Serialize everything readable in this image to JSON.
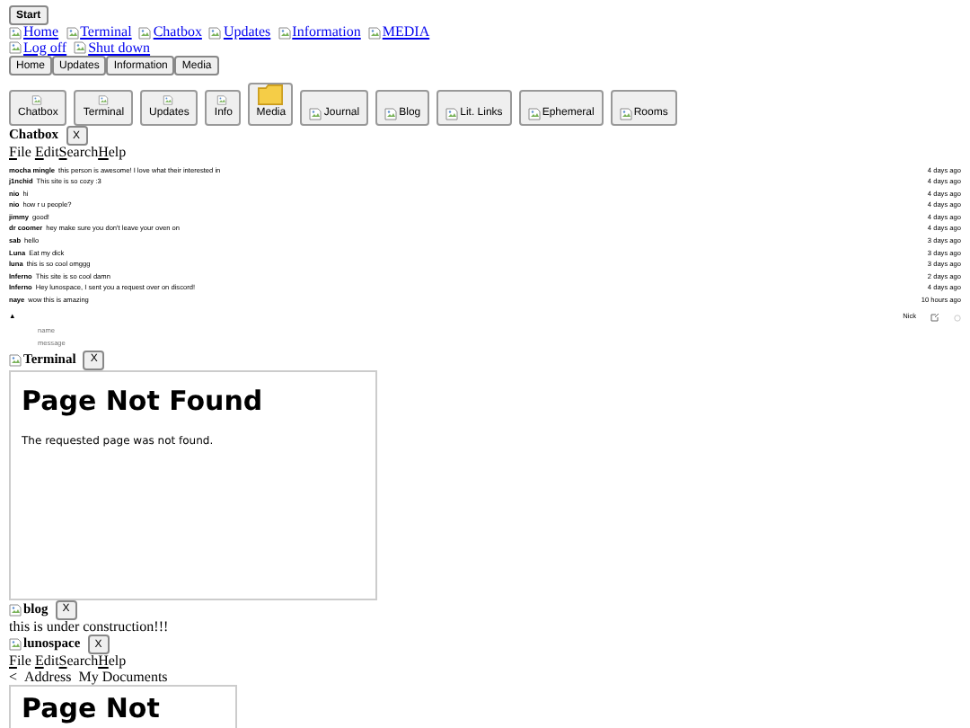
{
  "start_button": "Start",
  "desktop_links": [
    {
      "label": "Home"
    },
    {
      "label": "Terminal"
    },
    {
      "label": "Chatbox"
    },
    {
      "label": "Updates"
    },
    {
      "label": "Information"
    },
    {
      "label": "MEDIA"
    }
  ],
  "session_links": [
    {
      "label": "Log off"
    },
    {
      "label": "Shut down"
    }
  ],
  "shortcut_buttons": [
    "Home",
    "Updates",
    "Information",
    "Media"
  ],
  "icon_buttons": [
    {
      "label": "Chatbox",
      "kind": "stacked"
    },
    {
      "label": "Terminal",
      "kind": "stacked"
    },
    {
      "label": "Updates",
      "kind": "stacked"
    },
    {
      "label": "Info",
      "kind": "stacked"
    },
    {
      "label": "Media",
      "kind": "folder"
    },
    {
      "label": "Journal",
      "kind": "inline"
    },
    {
      "label": "Blog",
      "kind": "inline"
    },
    {
      "label": "Lit. Links",
      "kind": "inline"
    },
    {
      "label": "Ephemeral",
      "kind": "inline"
    },
    {
      "label": "Rooms",
      "kind": "inline"
    }
  ],
  "chatbox": {
    "title": "Chatbox",
    "close": "X",
    "menu": [
      "File",
      "Edit",
      "Search",
      "Help"
    ],
    "messages": [
      {
        "user": "mocha mingle",
        "text": "this person is awesome! I love what their interested in",
        "time": "4 days ago"
      },
      {
        "user": "j1nchid",
        "text": "This site is so cozy :3",
        "time": "4 days ago"
      },
      {
        "user": "nio",
        "text": "hi",
        "time": "4 days ago"
      },
      {
        "user": "nio",
        "text": "how r u people?",
        "time": "4 days ago"
      },
      {
        "user": "jimmy",
        "text": "good!",
        "time": "4 days ago"
      },
      {
        "user": "dr coomer",
        "text": "hey make sure you don't leave your oven on",
        "time": "4 days ago"
      },
      {
        "user": "sab",
        "text": "hello",
        "time": "3 days ago"
      },
      {
        "user": "Luna",
        "text": "Eat my dick",
        "time": "3 days ago"
      },
      {
        "user": "luna",
        "text": "this is so cool omggg",
        "time": "3 days ago"
      },
      {
        "user": "Inferno",
        "text": "This site is so cool damn",
        "time": "2 days ago"
      },
      {
        "user": "Inferno",
        "text": "Hey lunospace, I sent you a request over on discord!",
        "time": "4 days ago"
      },
      {
        "user": "naye",
        "text": "wow this is amazing",
        "time": "10 hours ago"
      }
    ],
    "scroll_up": "▲",
    "nick_label": "Nick",
    "name_placeholder": "name",
    "message_placeholder": "message"
  },
  "terminal": {
    "title": "Terminal",
    "close": "X",
    "heading": "Page Not Found",
    "text": "The requested page was not found."
  },
  "blog": {
    "title": "blog",
    "close": "X",
    "text": "this is under construction!!!"
  },
  "lunospace": {
    "title": "lunospace",
    "close": "X",
    "menu": [
      "File",
      "Edit",
      "Search",
      "Help"
    ],
    "back": "<",
    "address_label": "Address",
    "address": "My Documents",
    "heading": "Page Not"
  }
}
